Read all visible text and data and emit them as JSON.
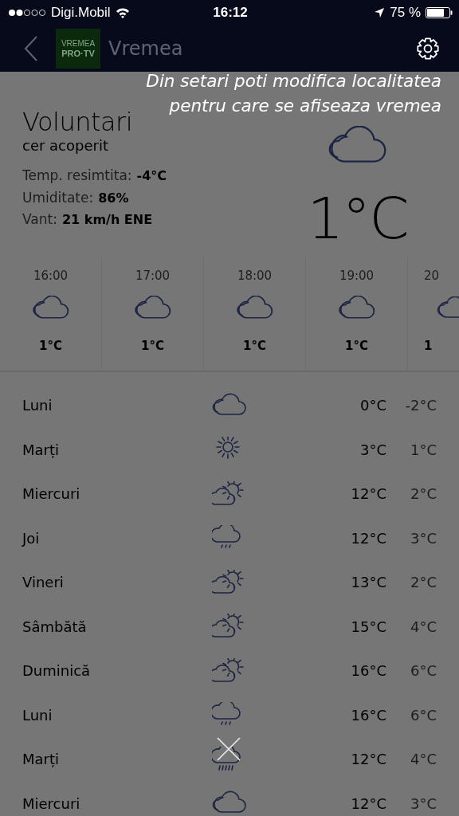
{
  "status_bar": {
    "carrier": "Digi.Mobil",
    "time": "16:12",
    "battery": "75 %"
  },
  "header": {
    "logo_lines": [
      "VREMEA",
      "PRO·TV"
    ],
    "title": "Vremea"
  },
  "tip": {
    "text": "Din setari poti modifica localitatea pentru care se afiseaza vremea"
  },
  "current": {
    "city": "Voluntari",
    "condition": "cer acoperit",
    "kind": "cloudy",
    "temperature": "1°C",
    "details": [
      {
        "label": "Temp. resimtita:",
        "value": "-4°C"
      },
      {
        "label": "Umiditate:",
        "value": "86%"
      },
      {
        "label": "Vant:",
        "value": "21 km/h ENE"
      }
    ]
  },
  "hourly": [
    {
      "time": "16:00",
      "kind": "cloudy",
      "temp": "1°C"
    },
    {
      "time": "17:00",
      "kind": "cloudy",
      "temp": "1°C"
    },
    {
      "time": "18:00",
      "kind": "cloudy",
      "temp": "1°C"
    },
    {
      "time": "19:00",
      "kind": "cloudy",
      "temp": "1°C"
    },
    {
      "time": "20",
      "kind": "cloudy",
      "temp": "1"
    }
  ],
  "daily": [
    {
      "day": "Luni",
      "kind": "cloudy",
      "high": "0°C",
      "low": "-2°C"
    },
    {
      "day": "Marți",
      "kind": "sunny",
      "high": "3°C",
      "low": "1°C"
    },
    {
      "day": "Miercuri",
      "kind": "partly",
      "high": "12°C",
      "low": "2°C"
    },
    {
      "day": "Joi",
      "kind": "rain",
      "high": "12°C",
      "low": "3°C"
    },
    {
      "day": "Vineri",
      "kind": "partly",
      "high": "13°C",
      "low": "2°C"
    },
    {
      "day": "Sâmbătă",
      "kind": "partly",
      "high": "15°C",
      "low": "4°C"
    },
    {
      "day": "Duminică",
      "kind": "partly",
      "high": "16°C",
      "low": "6°C"
    },
    {
      "day": "Luni",
      "kind": "rain",
      "high": "16°C",
      "low": "6°C"
    },
    {
      "day": "Marți",
      "kind": "heavy-rain",
      "high": "12°C",
      "low": "4°C"
    },
    {
      "day": "Miercuri",
      "kind": "cloudy",
      "high": "12°C",
      "low": "3°C"
    }
  ]
}
